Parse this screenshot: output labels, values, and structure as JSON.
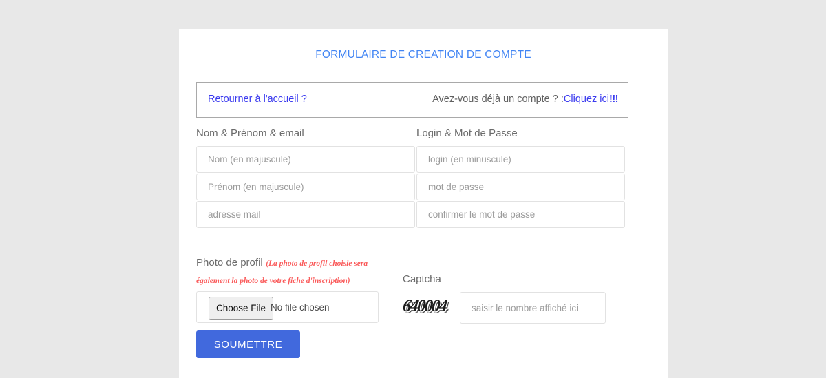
{
  "page": {
    "background_color": "#e8e8e8",
    "card_background_color": "#ffffff"
  },
  "form": {
    "title": "FORMULAIRE DE CREATION DE COMPTE",
    "title_color": "#4285f4"
  },
  "nav_box": {
    "home_link": "Retourner à l'accueil ?",
    "account_question": "Avez-vous déjà un compte ? :",
    "login_link": "Cliquez ici",
    "login_link_bangs": "!!!",
    "link_color": "#3a3aef",
    "border_color": "#a9a9a9"
  },
  "left_column": {
    "label": "Nom & Prénom & email",
    "fields": [
      {
        "name": "nom",
        "placeholder": "Nom (en majuscule)",
        "value": ""
      },
      {
        "name": "prenom",
        "placeholder": "Prénom (en majuscule)",
        "value": ""
      },
      {
        "name": "email",
        "placeholder": "adresse mail",
        "value": ""
      }
    ]
  },
  "right_column": {
    "label": "Login & Mot de Passe",
    "fields": [
      {
        "name": "login",
        "placeholder": "login (en minuscule)",
        "value": ""
      },
      {
        "name": "password",
        "placeholder": "mot de passe",
        "value": ""
      },
      {
        "name": "password_confirm",
        "placeholder": "confirmer le mot de passe",
        "value": ""
      }
    ]
  },
  "photo": {
    "label": "Photo de profil",
    "note_line1": "(La photo de profil choisie sera",
    "note_line2": "également la photo de votre fiche d'inscription)",
    "note_color": "#fa5a5a",
    "file_button_label": "Choose File",
    "file_status": "No file chosen"
  },
  "captcha": {
    "label": "Captcha",
    "code": "640004",
    "input_placeholder": "saisir le nombre affiché ici",
    "input_value": ""
  },
  "submit": {
    "label": "SOUMETTRE",
    "background_color": "#4169dd"
  }
}
